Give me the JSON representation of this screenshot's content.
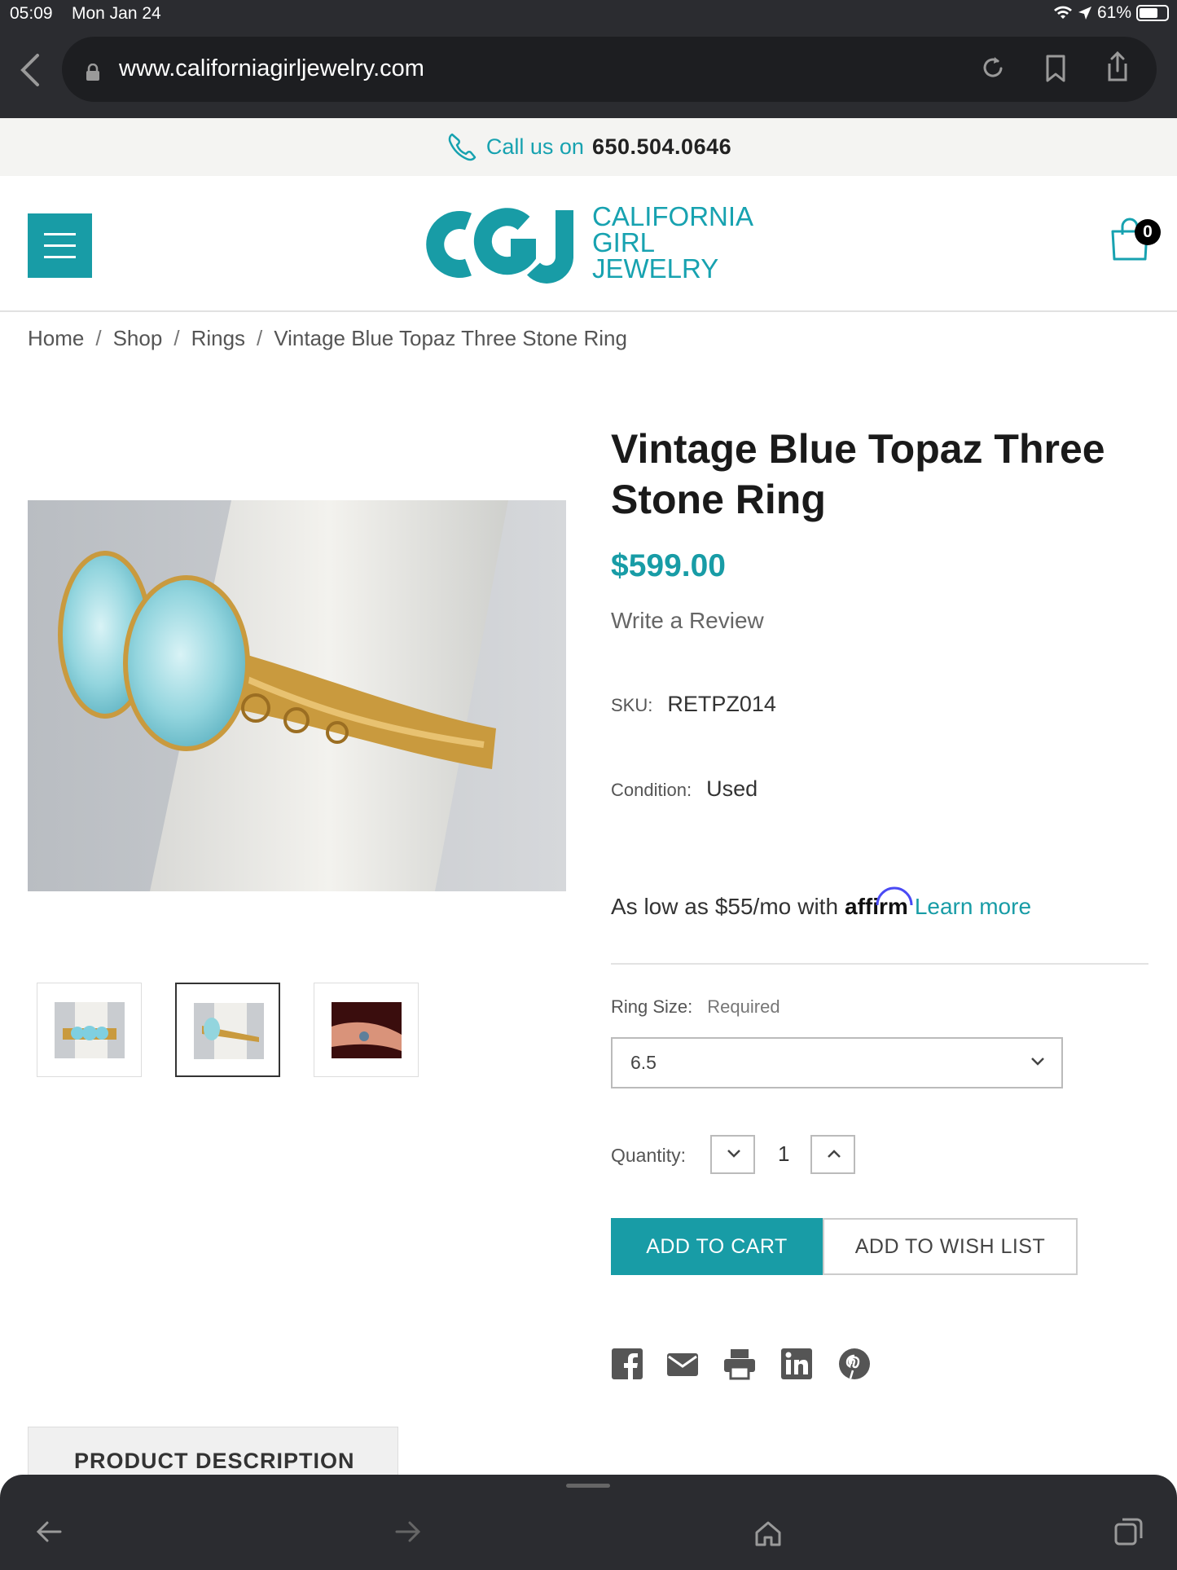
{
  "status_bar": {
    "time": "05:09",
    "date": "Mon Jan 24",
    "battery": "61%",
    "icons": [
      "wifi-icon",
      "location-icon",
      "battery-icon"
    ]
  },
  "browser": {
    "url": "www.californiagirljewelry.com",
    "icons": [
      "back-icon",
      "lock-icon",
      "reload-icon",
      "bookmark-icon",
      "share-icon"
    ]
  },
  "callbar": {
    "label": "Call us on",
    "number": "650.504.0646",
    "icon": "phone-icon"
  },
  "header": {
    "logo_mark": "CGJ",
    "logo_line1": "CALIFORNIA",
    "logo_line2": "GIRL",
    "logo_line3": "JEWELRY",
    "cart_count": "0",
    "brand_color": "#189ca6"
  },
  "breadcrumb": [
    {
      "label": "Home"
    },
    {
      "label": "Shop"
    },
    {
      "label": "Rings"
    },
    {
      "label": "Vintage Blue Topaz Three Stone Ring"
    }
  ],
  "breadcrumb_sep": "/",
  "product": {
    "title": "Vintage Blue Topaz Three Stone Ring",
    "price": "$599.00",
    "review_link": "Write a Review",
    "sku_label": "SKU:",
    "sku_value": "RETPZ014",
    "condition_label": "Condition:",
    "condition_value": "Used",
    "affirm_prefix": "As low as",
    "affirm_amount": "$55/mo",
    "affirm_with": "with",
    "affirm_brand": "affirm",
    "affirm_learn": "Learn more",
    "ring_size_label": "Ring Size:",
    "ring_size_required": "Required",
    "ring_size_value": "6.5",
    "quantity_label": "Quantity:",
    "quantity_value": "1",
    "add_to_cart": "ADD TO CART",
    "add_to_wishlist": "ADD TO WISH LIST",
    "thumbnails_selected": 1
  },
  "share_icons": [
    "facebook-icon",
    "email-icon",
    "print-icon",
    "linkedin-icon",
    "pinterest-icon"
  ],
  "tabs": {
    "description": "PRODUCT DESCRIPTION"
  },
  "bottom_toolbar": [
    "back-arrow-icon",
    "forward-arrow-icon",
    "home-icon",
    "tabs-icon"
  ]
}
